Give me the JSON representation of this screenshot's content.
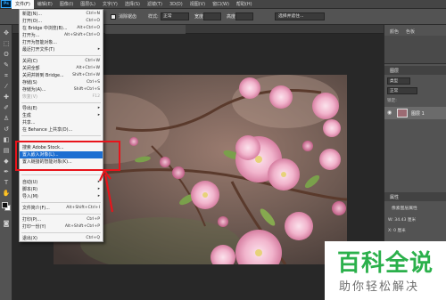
{
  "menubar": {
    "logo": "Ps",
    "items": [
      "文件(F)",
      "编辑(E)",
      "图像(I)",
      "图层(L)",
      "文字(Y)",
      "选择(S)",
      "滤镜(T)",
      "3D(D)",
      "视图(V)",
      "窗口(W)",
      "帮助(H)"
    ],
    "active_index": 0
  },
  "options": {
    "check_label": "消除锯齿",
    "style_label": "样式:",
    "style_value": "正常",
    "width_label": "宽度:",
    "height_label": "高度:",
    "select_mask_label": "选择并遮住..."
  },
  "file_menu": {
    "items": [
      {
        "label": "新建(N)...",
        "shortcut": "Ctrl+N"
      },
      {
        "label": "打开(O)...",
        "shortcut": "Ctrl+O"
      },
      {
        "label": "在 Bridge 中浏览(B)...",
        "shortcut": "Alt+Ctrl+O"
      },
      {
        "label": "打开为...",
        "shortcut": "Alt+Shift+Ctrl+O"
      },
      {
        "label": "打开为智能对象..."
      },
      {
        "label": "最近打开文件(T)",
        "submenu": true
      },
      {
        "label": "关闭(C)",
        "shortcut": "Ctrl+W"
      },
      {
        "label": "关闭全部",
        "shortcut": "Alt+Ctrl+W"
      },
      {
        "label": "关闭并转到 Bridge...",
        "shortcut": "Shift+Ctrl+W"
      },
      {
        "label": "存储(S)",
        "shortcut": "Ctrl+S"
      },
      {
        "label": "存储为(A)...",
        "shortcut": "Shift+Ctrl+S"
      },
      {
        "label": "恢复(V)",
        "shortcut": "F12",
        "disabled": true
      },
      {
        "label": "导出(E)",
        "submenu": true
      },
      {
        "label": "生成",
        "submenu": true
      },
      {
        "label": "共享..."
      },
      {
        "label": "在 Behance 上共享(D)..."
      },
      {
        "label": "搜索 Adobe Stock..."
      },
      {
        "label": "置入嵌入对象(L)...",
        "highlight": true
      },
      {
        "label": "置入链接的智能对象(K)..."
      },
      {
        "label": "自动(U)",
        "submenu": true
      },
      {
        "label": "脚本(R)",
        "submenu": true
      },
      {
        "label": "导入(M)",
        "submenu": true
      },
      {
        "label": "文件简介(F)...",
        "shortcut": "Alt+Shift+Ctrl+I"
      },
      {
        "label": "打印(P)...",
        "shortcut": "Ctrl+P"
      },
      {
        "label": "打印一份(Y)",
        "shortcut": "Alt+Shift+Ctrl+P"
      },
      {
        "label": "退出(X)",
        "shortcut": "Ctrl+Q"
      }
    ]
  },
  "panels": {
    "top_tabs": [
      "颜色",
      "色板"
    ],
    "layers_tab": "图层",
    "kind": "类型",
    "blend_mode": "正常",
    "lock_label": "锁定:",
    "layer_name": "图层 1",
    "properties_tab": "属性",
    "properties_type": "像素图层属性",
    "width_label": "W: 34.43 厘米",
    "x_label": "X: 0 厘米"
  },
  "watermark": {
    "title": "百科全说",
    "subtitle": "助你轻松解决"
  },
  "colors": {
    "highlight": "#1c6ed1",
    "annotation_red": "#e8141b",
    "watermark_green": "#2bb04b"
  }
}
